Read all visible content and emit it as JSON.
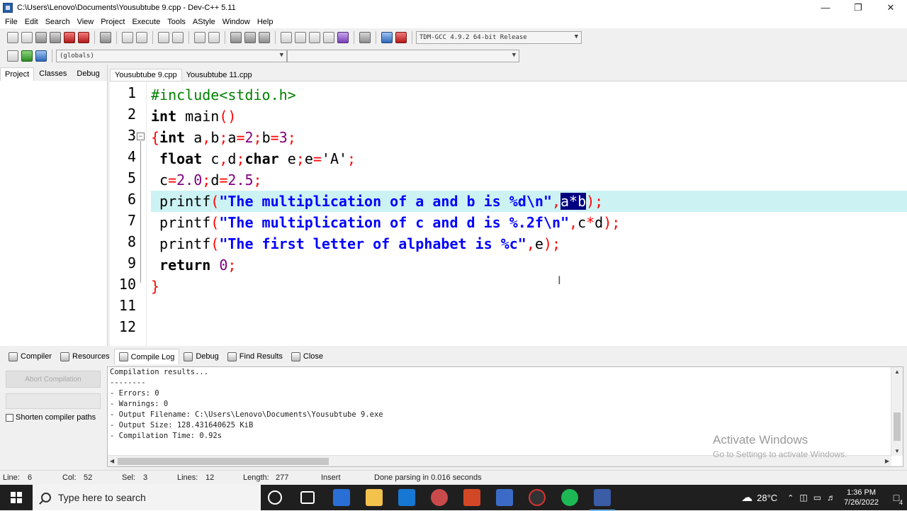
{
  "window": {
    "title": "C:\\Users\\Lenovo\\Documents\\Yousubtube 9.cpp - Dev-C++ 5.11"
  },
  "menu": [
    "File",
    "Edit",
    "Search",
    "View",
    "Project",
    "Execute",
    "Tools",
    "AStyle",
    "Window",
    "Help"
  ],
  "toolbar": {
    "compiler_select": "TDM-GCC 4.9.2 64-bit Release",
    "scope_select": "(globals)"
  },
  "left_panel": {
    "tabs": [
      "Project",
      "Classes",
      "Debug"
    ]
  },
  "editor": {
    "tabs": [
      "Yousubtube 9.cpp",
      "Yousubtube 11.cpp"
    ],
    "line_numbers": [
      "1",
      "2",
      "3",
      "4",
      "5",
      "6",
      "7",
      "8",
      "9",
      "10",
      "11",
      "12"
    ],
    "current_line": 6,
    "selected_text": "a*b"
  },
  "bottom_panel": {
    "tabs": [
      "Compiler",
      "Resources",
      "Compile Log",
      "Debug",
      "Find Results",
      "Close"
    ],
    "active_tab": "Compile Log",
    "abort_button": "Abort Compilation",
    "shorten_label": "Shorten compiler paths",
    "log_lines": [
      "Compilation results...",
      "--------",
      "- Errors: 0",
      "- Warnings: 0",
      "- Output Filename: C:\\Users\\Lenovo\\Documents\\Yousubtube 9.exe",
      "- Output Size: 128.431640625 KiB",
      "- Compilation Time: 0.92s"
    ],
    "watermark_title": "Activate Windows",
    "watermark_sub": "Go to Settings to activate Windows."
  },
  "status": {
    "line_label": "Line:",
    "line_value": "6",
    "col_label": "Col:",
    "col_value": "52",
    "sel_label": "Sel:",
    "sel_value": "3",
    "lines_label": "Lines:",
    "lines_value": "12",
    "length_label": "Length:",
    "length_value": "277",
    "mode": "Insert",
    "message": "Done parsing in 0.016 seconds"
  },
  "taskbar": {
    "search_placeholder": "Type here to search",
    "weather": "28°C",
    "time": "1:36 PM",
    "date": "7/26/2022",
    "notification_count": "4"
  }
}
